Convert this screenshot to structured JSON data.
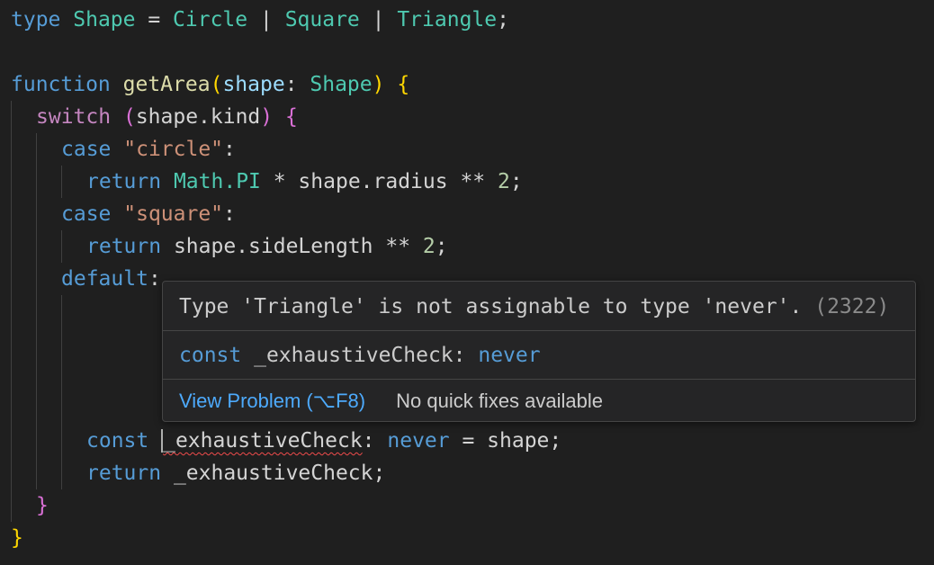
{
  "code": {
    "line1": {
      "kw_type": "type",
      "name": "Shape",
      "eq": " = ",
      "t1": "Circle",
      "pipe1": " | ",
      "t2": "Square",
      "pipe2": " | ",
      "t3": "Triangle",
      "semi": ";"
    },
    "line3": {
      "kw_function": "function",
      "fn_name": "getArea",
      "paren_open": "(",
      "param": "shape",
      "colon": ": ",
      "param_type": "Shape",
      "paren_close": ")",
      "brace": "{"
    },
    "line4": {
      "kw_switch": "switch",
      "paren_open": "(",
      "expr": "shape.kind",
      "paren_close": ")",
      "brace": "{"
    },
    "line5": {
      "kw_case": "case",
      "value": "\"circle\"",
      "colon": ":"
    },
    "line6": {
      "kw_return": "return",
      "math": "Math",
      "pi": ".PI",
      "rest": " * shape.radius ** ",
      "num": "2",
      "semi": ";"
    },
    "line7": {
      "kw_case": "case",
      "value": "\"square\"",
      "colon": ":"
    },
    "line8": {
      "kw_return": "return",
      "rest": " shape.sideLength ** ",
      "num": "2",
      "semi": ";"
    },
    "line9": {
      "kw_default": "default",
      "colon": ":"
    },
    "line13": {
      "kw_const": "const",
      "ident": "_exhaustiveCheck",
      "colon": ": ",
      "type_never": "never",
      "rest": " = shape;"
    },
    "line14": {
      "kw_return": "return",
      "rest": " _exhaustiveCheck;"
    },
    "line15": {
      "brace": "}"
    },
    "line16": {
      "brace": "}"
    }
  },
  "hover": {
    "message": "Type 'Triangle' is not assignable to type 'never'.",
    "error_code": "(2322)",
    "signature_const": "const",
    "signature_name": " _exhaustiveCheck",
    "signature_colon": ": ",
    "signature_type": "never",
    "view_problem_label": "View Problem (⌥F8)",
    "no_quick_fixes_label": "No quick fixes available"
  },
  "colors": {
    "background": "#1f1f1f",
    "keyword": "#569cd6",
    "control_keyword": "#c586c0",
    "type": "#4ec9b0",
    "function": "#dcdcaa",
    "string": "#ce9178",
    "number": "#b5cea8",
    "error_squiggle": "#f14c4c",
    "link": "#4daafc"
  }
}
